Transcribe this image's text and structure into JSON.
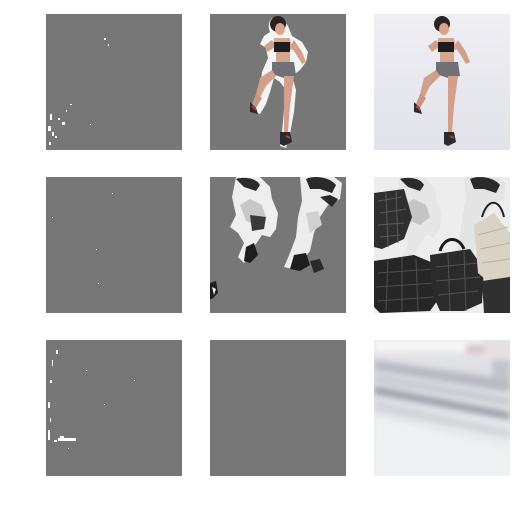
{
  "figure": {
    "rows": [
      {
        "panels": [
          {
            "kind": "mask",
            "content": "sparse-specks",
            "background": "#777777"
          },
          {
            "kind": "masked-image",
            "content": "athlete-jumping",
            "background": "#777777"
          },
          {
            "kind": "photo",
            "content": "athlete-jumping",
            "background": "#ededf1"
          }
        ]
      },
      {
        "panels": [
          {
            "kind": "mask",
            "content": "nearly-empty",
            "background": "#777777"
          },
          {
            "kind": "masked-image",
            "content": "fashion-models-bags",
            "background": "#777777"
          },
          {
            "kind": "photo",
            "content": "fashion-models-bags",
            "background": "#f4f4f4"
          }
        ]
      },
      {
        "panels": [
          {
            "kind": "mask",
            "content": "sparse-specks",
            "background": "#777777"
          },
          {
            "kind": "masked-image",
            "content": "empty",
            "background": "#777777"
          },
          {
            "kind": "photo",
            "content": "blurred-corridor",
            "background": "#e9ecef"
          }
        ]
      }
    ]
  }
}
